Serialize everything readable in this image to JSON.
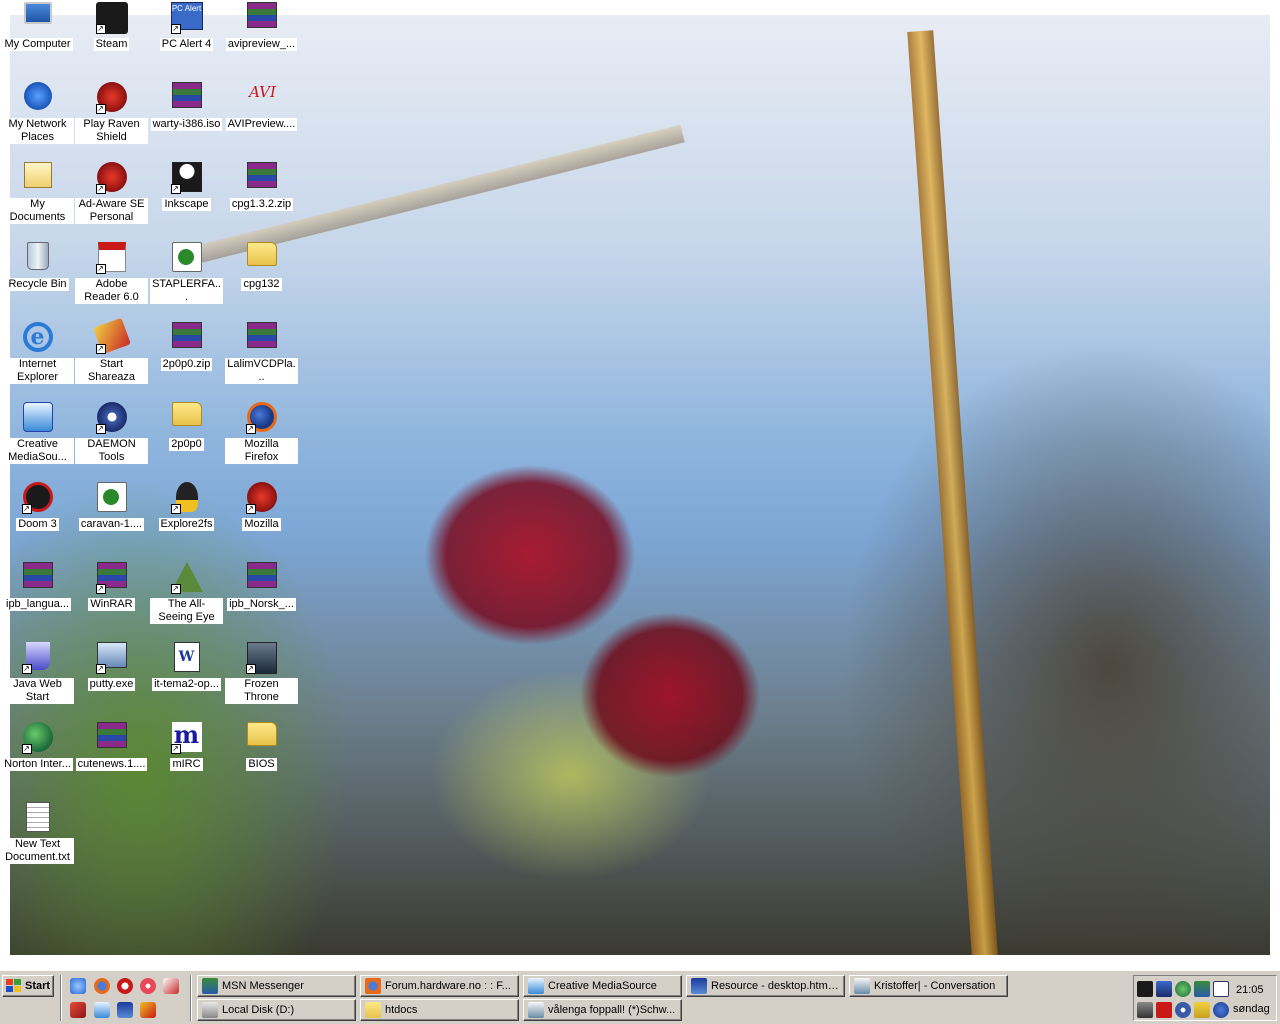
{
  "desktop": {
    "icons": [
      {
        "label": "My Computer",
        "icon": "my-computer-icon",
        "shortcut": false
      },
      {
        "label": "Steam",
        "icon": "steam-icon",
        "shortcut": true
      },
      {
        "label": "PC Alert 4",
        "icon": "pc-alert-icon",
        "shortcut": true
      },
      {
        "label": "avipreview_...",
        "icon": "winrar-archive-icon",
        "shortcut": false
      },
      {
        "label": "My Network Places",
        "icon": "network-places-icon",
        "shortcut": false
      },
      {
        "label": "Play Raven Shield",
        "icon": "raven-shield-icon",
        "shortcut": true
      },
      {
        "label": "warty-i386.iso",
        "icon": "winrar-archive-icon",
        "shortcut": false
      },
      {
        "label": "AVIPreview....",
        "icon": "avipreview-icon",
        "shortcut": false
      },
      {
        "label": "My Documents",
        "icon": "my-documents-icon",
        "shortcut": false
      },
      {
        "label": "Ad-Aware SE Personal",
        "icon": "ad-aware-icon",
        "shortcut": true
      },
      {
        "label": "Inkscape",
        "icon": "inkscape-icon",
        "shortcut": true
      },
      {
        "label": "cpg1.3.2.zip",
        "icon": "winrar-archive-icon",
        "shortcut": false
      },
      {
        "label": "Recycle Bin",
        "icon": "recycle-bin-icon",
        "shortcut": false
      },
      {
        "label": "Adobe Reader 6.0",
        "icon": "adobe-reader-icon",
        "shortcut": true
      },
      {
        "label": "STAPLERFA...",
        "icon": "media-file-icon",
        "shortcut": false
      },
      {
        "label": "cpg132",
        "icon": "folder-icon",
        "shortcut": false
      },
      {
        "label": "Internet Explorer",
        "icon": "internet-explorer-icon",
        "shortcut": false
      },
      {
        "label": "Start Shareaza",
        "icon": "shareaza-icon",
        "shortcut": true
      },
      {
        "label": "2p0p0.zip",
        "icon": "winrar-archive-icon",
        "shortcut": false
      },
      {
        "label": "LalimVCDPla...",
        "icon": "winrar-archive-icon",
        "shortcut": false
      },
      {
        "label": "Creative MediaSou...",
        "icon": "creative-mediasource-icon",
        "shortcut": false
      },
      {
        "label": "DAEMON Tools",
        "icon": "daemon-tools-icon",
        "shortcut": true
      },
      {
        "label": "2p0p0",
        "icon": "folder-icon",
        "shortcut": false
      },
      {
        "label": "Mozilla Firefox",
        "icon": "firefox-icon",
        "shortcut": true
      },
      {
        "label": "Doom 3",
        "icon": "doom3-icon",
        "shortcut": true
      },
      {
        "label": "caravan-1....",
        "icon": "media-file-icon",
        "shortcut": false
      },
      {
        "label": "Explore2fs",
        "icon": "penguin-icon",
        "shortcut": true
      },
      {
        "label": "Mozilla",
        "icon": "mozilla-icon",
        "shortcut": true
      },
      {
        "label": "ipb_langua...",
        "icon": "winrar-archive-icon",
        "shortcut": false
      },
      {
        "label": "WinRAR",
        "icon": "winrar-icon",
        "shortcut": true
      },
      {
        "label": "The All-Seeing Eye",
        "icon": "all-seeing-eye-icon",
        "shortcut": true
      },
      {
        "label": "ipb_Norsk_...",
        "icon": "winrar-archive-icon",
        "shortcut": false
      },
      {
        "label": "Java Web Start",
        "icon": "java-icon",
        "shortcut": true
      },
      {
        "label": "putty.exe",
        "icon": "putty-icon",
        "shortcut": true
      },
      {
        "label": "it-tema2-op...",
        "icon": "word-document-icon",
        "shortcut": false
      },
      {
        "label": "Frozen Throne",
        "icon": "frozen-throne-icon",
        "shortcut": true
      },
      {
        "label": "Norton Inter...",
        "icon": "norton-icon",
        "shortcut": true
      },
      {
        "label": "cutenews.1....",
        "icon": "winrar-archive-icon",
        "shortcut": false
      },
      {
        "label": "mIRC",
        "icon": "mirc-icon",
        "shortcut": true
      },
      {
        "label": "BIOS",
        "icon": "folder-icon",
        "shortcut": false
      },
      {
        "label": "New Text Document.txt",
        "icon": "text-document-icon",
        "shortcut": false
      }
    ]
  },
  "taskbar": {
    "start_label": "Start",
    "tasks_row1": [
      {
        "label": "MSN Messenger",
        "icon": "msn-messenger-icon"
      },
      {
        "label": "Forum.hardware.no : : F...",
        "icon": "firefox-icon"
      },
      {
        "label": "Creative MediaSource",
        "icon": "creative-mediasource-icon"
      },
      {
        "label": "Resource - desktop.html ...",
        "icon": "resource-editor-icon"
      },
      {
        "label": "Kristoffer| - Conversation",
        "icon": "conversation-icon"
      }
    ],
    "tasks_row2": [
      {
        "label": "Local Disk (D:)",
        "icon": "drive-icon"
      },
      {
        "label": "htdocs",
        "icon": "folder-icon"
      },
      {
        "label": "vålenga foppall! (*)Schw...",
        "icon": "conversation-icon"
      }
    ],
    "clock": {
      "time": "21:05",
      "day": "søndag"
    }
  },
  "colors": {
    "taskbar": "#d4d0c8",
    "label_bg": "#ffffff"
  }
}
